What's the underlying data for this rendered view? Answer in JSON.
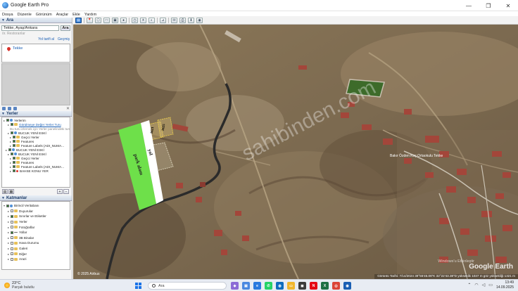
{
  "window": {
    "title": "Google Earth Pro",
    "minimize": "—",
    "maximize": "❐",
    "close": "✕"
  },
  "menu": [
    "Dosya",
    "Düzenle",
    "Görünüm",
    "Araçlar",
    "Ekle",
    "Yardım"
  ],
  "search": {
    "header": "Ara",
    "value": "Tekke, Ayaş/Ankara",
    "button": "Ara",
    "hint": "ör. Restoranlar",
    "links": [
      "Yol tarifi al",
      "Geçmiş"
    ],
    "result": "Tekke"
  },
  "places": {
    "header": "Yerler",
    "items": [
      {
        "label": "Yerlerim",
        "style": "normal",
        "icon": "globe"
      },
      {
        "label": "Görülmeye Değer Yerler Turu",
        "style": "link",
        "icon": "folder"
      },
      {
        "label": "Bu turu izlemek için Yerler panelindeki turu tıklayın",
        "style": "gray",
        "icon": "none"
      },
      {
        "label": "BUCUK YENİ ESKİ",
        "style": "normal",
        "icon": "globe"
      },
      {
        "label": "Geçici Yerler",
        "style": "normal",
        "icon": "folder"
      },
      {
        "label": "Features",
        "style": "normal",
        "icon": "folder"
      },
      {
        "label": "Feature Labels (ADI_NUMA...",
        "style": "normal",
        "icon": "folder"
      },
      {
        "label": "BUCUK YENİ ESKİ",
        "style": "normal",
        "icon": "globe"
      },
      {
        "label": "BUCUK YENİ ESKİ",
        "style": "normal",
        "icon": "globe"
      },
      {
        "label": "Geçici Yerler",
        "style": "normal",
        "icon": "folder"
      },
      {
        "label": "Features",
        "style": "normal",
        "icon": "folder"
      },
      {
        "label": "Feature Labels (ADI_NUMA...",
        "style": "normal",
        "icon": "folder"
      },
      {
        "label": "BAHSE KONU YER",
        "style": "normal",
        "icon": "pin"
      }
    ]
  },
  "layers": {
    "header": "Katmanlar",
    "items": [
      {
        "label": "Birincil Veritabanı",
        "icon": "globe"
      },
      {
        "label": "Duyurular",
        "icon": "folder"
      },
      {
        "label": "Sınırlar ve Etiketler",
        "icon": "folder"
      },
      {
        "label": "Yerler",
        "icon": "folder"
      },
      {
        "label": "Fotoğraflar",
        "icon": "folder"
      },
      {
        "label": "Yollar",
        "icon": "line"
      },
      {
        "label": "3B Binalar",
        "icon": "folder"
      },
      {
        "label": "Hava Durumu",
        "icon": "folder"
      },
      {
        "label": "Galeri",
        "icon": "folder"
      },
      {
        "label": "Diğer",
        "icon": "folder"
      },
      {
        "label": "Arazi",
        "icon": "folder"
      }
    ]
  },
  "map": {
    "overlay_main": "yol",
    "overlay_sub": "park alanı",
    "parcel_1": "1621",
    "parcel_2": "1625",
    "watermark": "sahibinden.com",
    "activate": "Windows'u Etkinleştir",
    "brand": "Google Earth",
    "status": "Görüntü Tarihi: 7/14/2024   39°55'45.06\"K   32°22'43.38\"D   yükseklik 1037 m   göz yüksekliği 1321 m",
    "scale": "© 2025 Airbus",
    "place_label": "Bakır Özden Koç Ortaokulu Tekke"
  },
  "taskbar": {
    "temp": "23°C",
    "weather": "Parçalı bulutlu",
    "search": "Ara",
    "time": "13:49",
    "date": "14.09.2025"
  },
  "colors": {
    "accent": "#1a5fb4",
    "overlay_green": "#6ee04a",
    "road": "#2b2b2b"
  }
}
